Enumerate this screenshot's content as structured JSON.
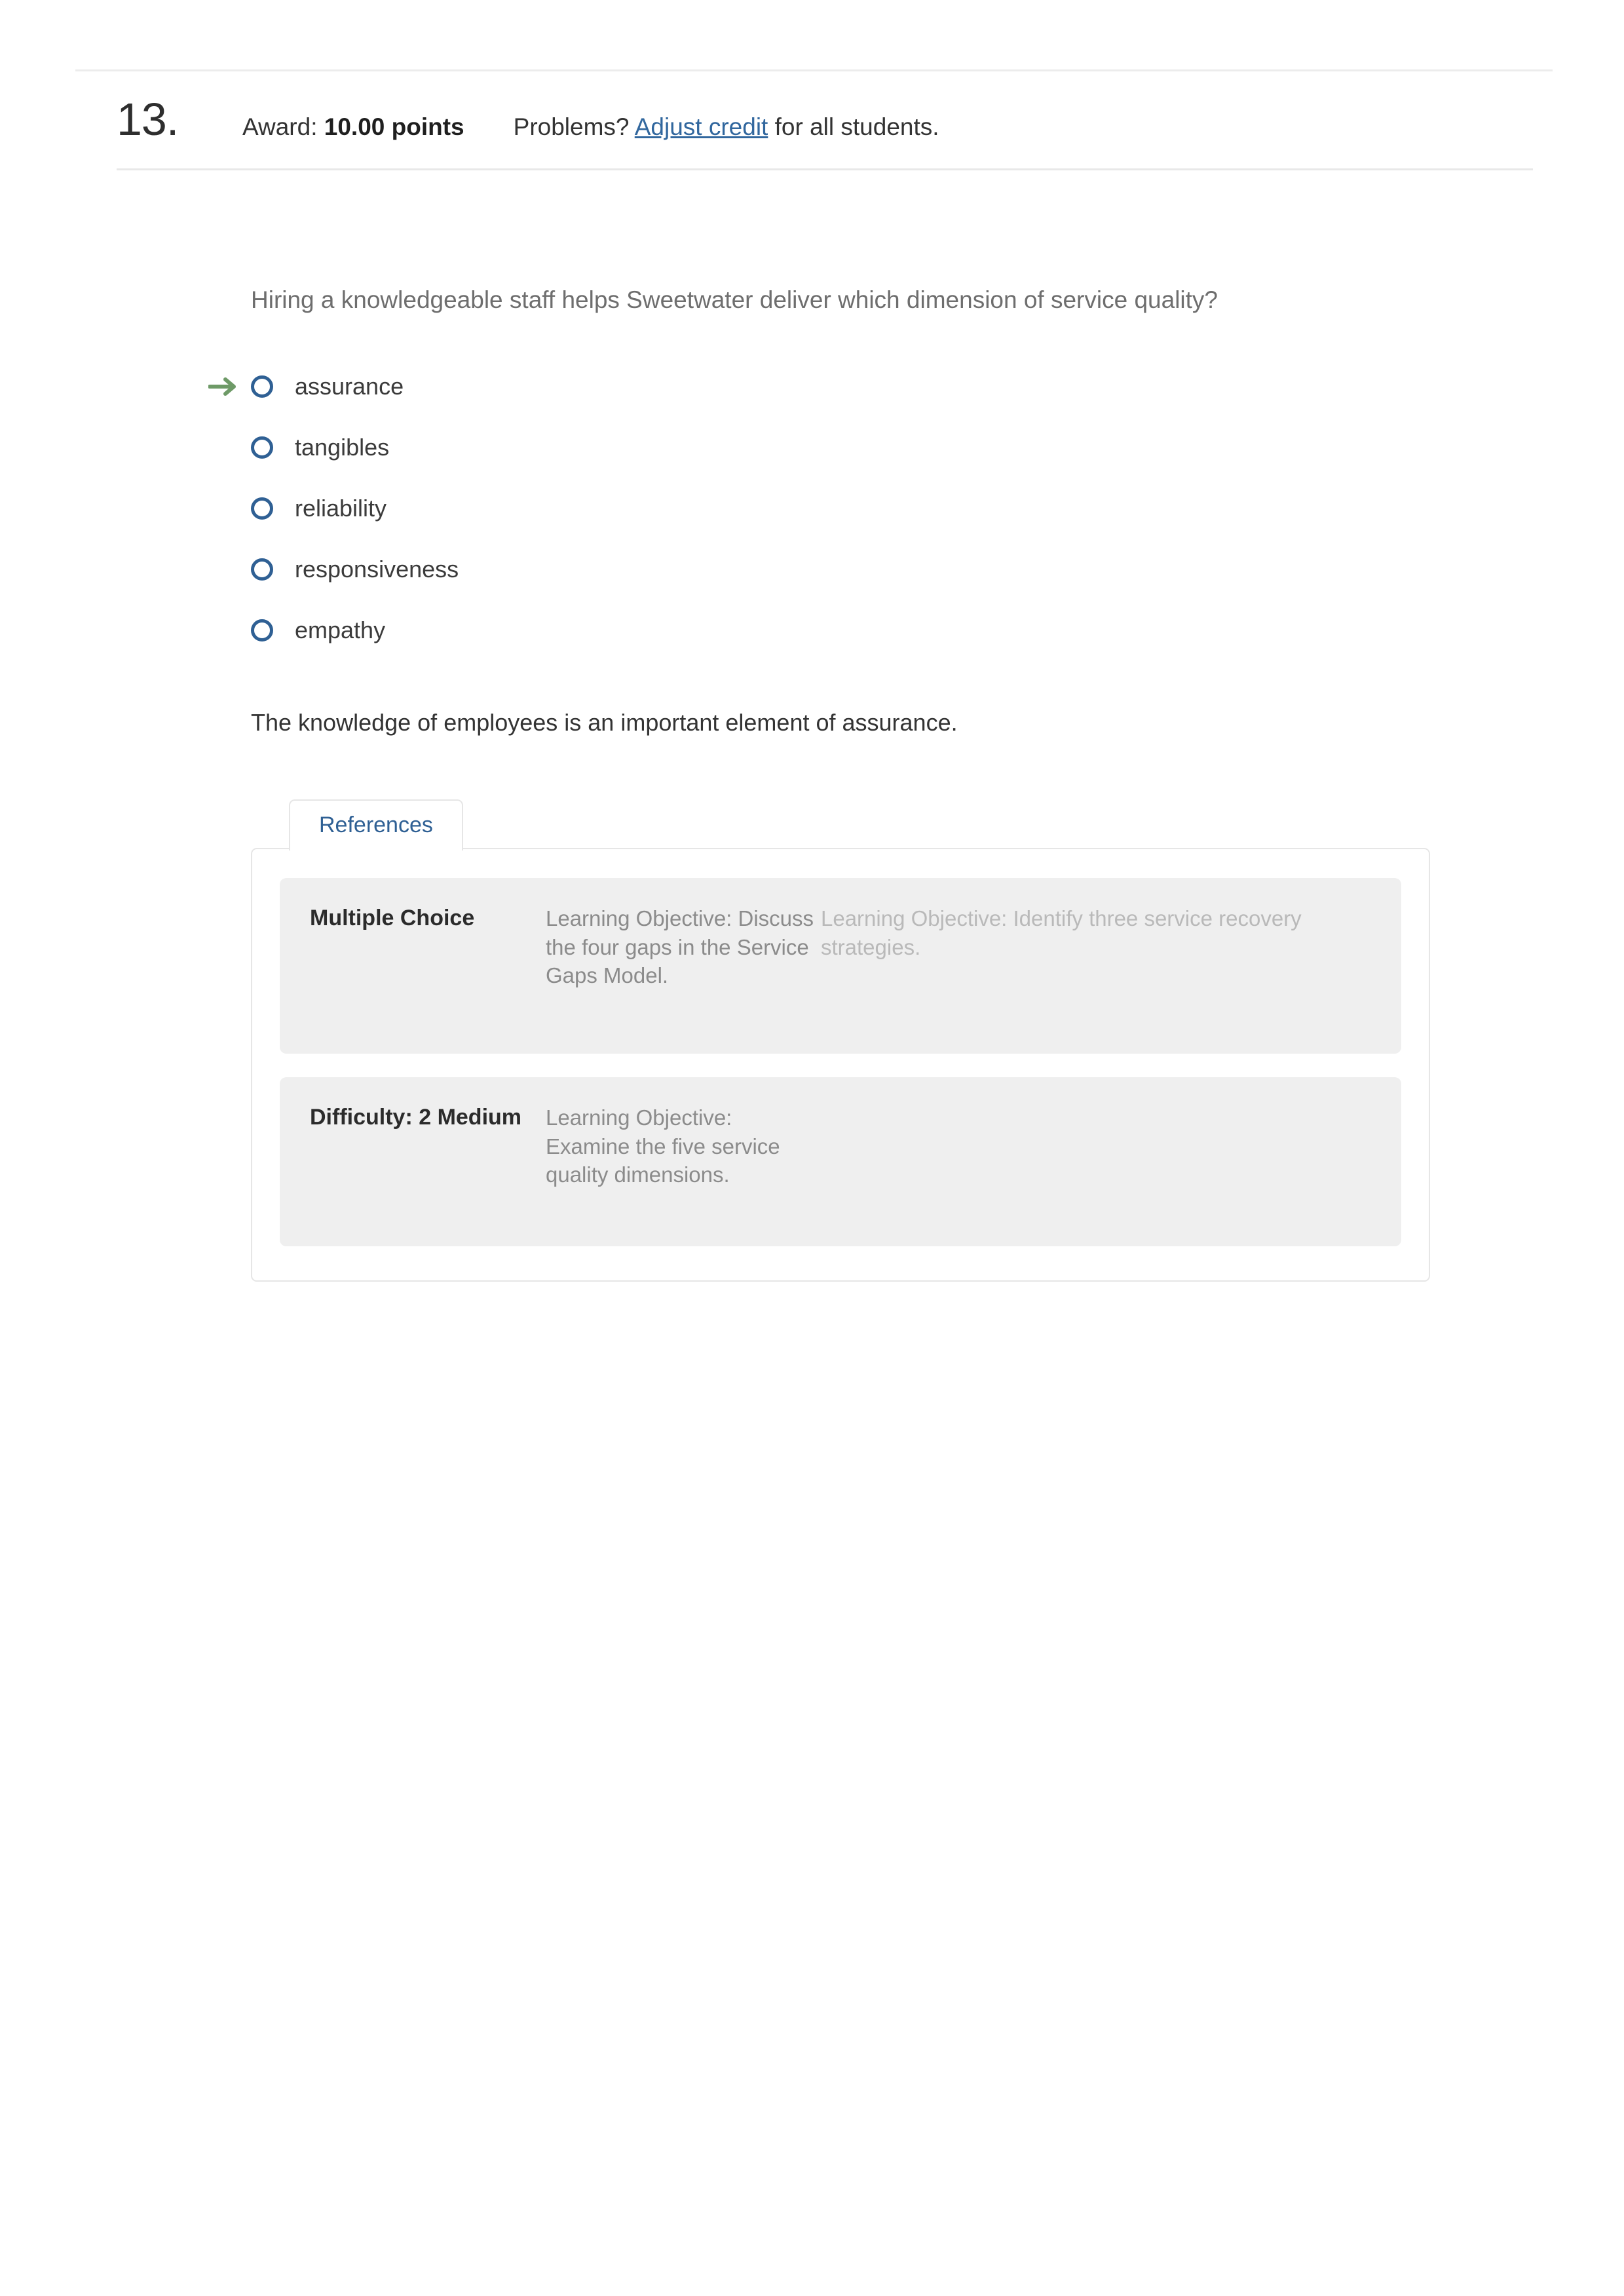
{
  "header": {
    "question_number": "13.",
    "award_label": "Award:",
    "award_value": "10.00 points",
    "problems_label": "Problems?",
    "adjust_credit_link": "Adjust credit",
    "problems_suffix": "for all students."
  },
  "question": {
    "stem": "Hiring a knowledgeable staff helps Sweetwater deliver which dimension of service quality?",
    "choices": [
      {
        "label": "assurance",
        "marked_correct": true
      },
      {
        "label": "tangibles",
        "marked_correct": false
      },
      {
        "label": "reliability",
        "marked_correct": false
      },
      {
        "label": "responsiveness",
        "marked_correct": false
      },
      {
        "label": "empathy",
        "marked_correct": false
      }
    ],
    "explanation": "The knowledge of employees is an important element of assurance."
  },
  "references": {
    "tab_label": "References",
    "rows": [
      {
        "type": "Multiple Choice",
        "objective_primary": "Learning Objective: Discuss the four gaps in the Service Gaps Model.",
        "objective_secondary": "Learning Objective: Identify three service recovery strategies."
      },
      {
        "type": "Difficulty: 2 Medium",
        "objective_primary": "Learning Objective: Examine the five service quality dimensions.",
        "objective_secondary": ""
      }
    ]
  },
  "colors": {
    "link_blue": "#31679e",
    "tab_blue": "#2f6094",
    "radio_blue": "#2f6094",
    "arrow_green": "#6e9a67",
    "row_gray": "#efefef",
    "border_gray": "#e6e6e6"
  }
}
